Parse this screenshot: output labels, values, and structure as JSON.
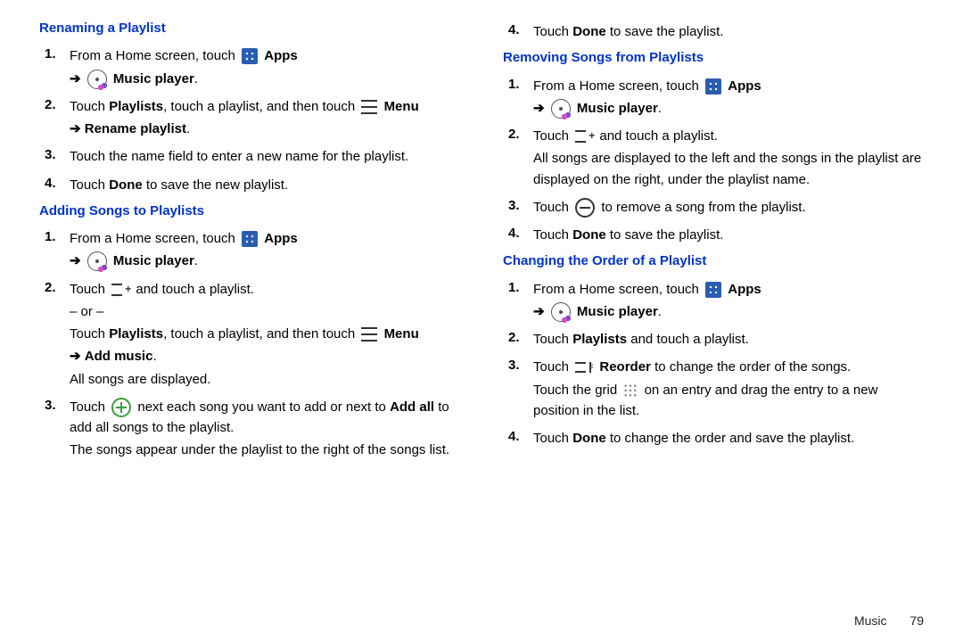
{
  "left": {
    "sec1": {
      "heading": "Renaming a Playlist",
      "s1a": "From a Home screen, touch ",
      "apps": "Apps",
      "s1b": "Music player",
      "s2a": "Touch ",
      "s2b": "Playlists",
      "s2c": ", touch a playlist, and then touch ",
      "menu": "Menu",
      "s2d": "Rename playlist",
      "s3": "Touch the name field to enter a new name for the playlist.",
      "s4a": "Touch ",
      "s4b": "Done",
      "s4c": " to save the new playlist."
    },
    "sec2": {
      "heading": "Adding Songs to Playlists",
      "s1a": "From a Home screen, touch ",
      "apps": "Apps",
      "s1b": "Music player",
      "s2a": "Touch ",
      "s2b": " and touch a playlist.",
      "or": "– or –",
      "s2c": "Touch ",
      "s2d": "Playlists",
      "s2e": ", touch a playlist, and then touch ",
      "menu": "Menu",
      "addmusic": "Add music",
      "s2f": "All songs are displayed.",
      "s3a": "Touch ",
      "s3b": " next each song you want to add or next to ",
      "s3c": "Add all",
      "s3d": " to add all songs to the playlist.",
      "s3e": "The songs appear under the playlist to the right of the songs list."
    }
  },
  "right": {
    "top4a": "Touch ",
    "top4b": "Done",
    "top4c": " to save the playlist.",
    "sec3": {
      "heading": "Removing Songs from Playlists",
      "s1a": "From a Home screen, touch ",
      "apps": "Apps",
      "s1b": "Music player",
      "s2a": "Touch ",
      "s2b": " and touch a playlist.",
      "s2c": "All songs are displayed to the left and the songs in the playlist are displayed on the right, under the playlist name.",
      "s3a": "Touch ",
      "s3b": " to remove a song from the playlist.",
      "s4a": "Touch ",
      "s4b": "Done",
      "s4c": " to save the playlist."
    },
    "sec4": {
      "heading": "Changing the Order of a Playlist",
      "s1a": "From a Home screen, touch ",
      "apps": "Apps",
      "s1b": "Music player",
      "s2a": "Touch ",
      "s2b": "Playlists",
      "s2c": " and touch a playlist.",
      "s3a": "Touch ",
      "s3b": "Reorder",
      "s3c": " to change the order of the songs.",
      "s3d": "Touch the grid ",
      "s3e": " on an entry and drag the entry to a new position in the list.",
      "s4a": "Touch ",
      "s4b": "Done",
      "s4c": " to change the order and save the playlist."
    }
  },
  "arrow": "➔",
  "dot": ".",
  "footer": {
    "section": "Music",
    "page": "79"
  }
}
